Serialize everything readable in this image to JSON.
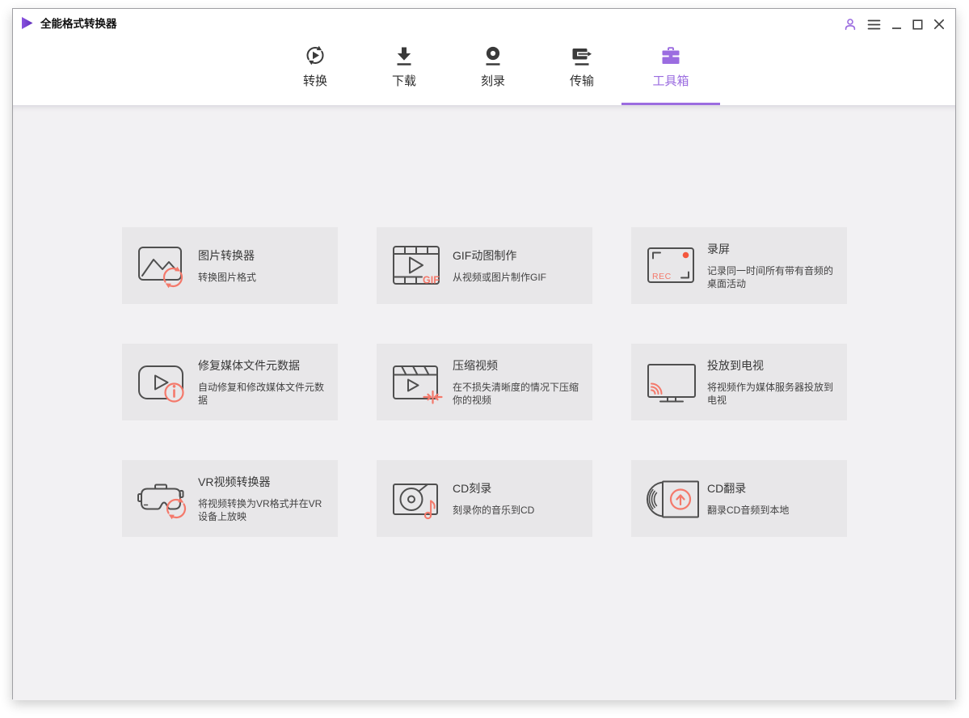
{
  "window": {
    "title": "全能格式转换器"
  },
  "colors": {
    "accent_purple": "#9b6ce0",
    "accent_coral": "#f4796b",
    "record_red": "#f4573d",
    "card_bg": "#e8e7e9",
    "content_bg": "#f2f1f3"
  },
  "nav": {
    "tabs": [
      {
        "label": "转换",
        "icon": "convert-icon",
        "active": false
      },
      {
        "label": "下载",
        "icon": "download-icon",
        "active": false
      },
      {
        "label": "刻录",
        "icon": "burn-icon",
        "active": false
      },
      {
        "label": "传输",
        "icon": "transfer-icon",
        "active": false
      },
      {
        "label": "工具箱",
        "icon": "toolbox-icon",
        "active": true
      }
    ]
  },
  "icon_labels": {
    "gif": "GIF",
    "rec": "REC"
  },
  "toolbox": {
    "cards": [
      {
        "title": "图片转换器",
        "subtitle": "转换图片格式",
        "icon": "image-converter-icon"
      },
      {
        "title": "GIF动图制作",
        "subtitle": "从视频或图片制作GIF",
        "icon": "gif-maker-icon"
      },
      {
        "title": "录屏",
        "subtitle": "记录同一时间所有带有音频的桌面活动",
        "icon": "screen-recorder-icon"
      },
      {
        "title": "修复媒体文件元数据",
        "subtitle": "自动修复和修改媒体文件元数据",
        "icon": "fix-metadata-icon"
      },
      {
        "title": "压缩视频",
        "subtitle": "在不损失清晰度的情况下压缩你的视频",
        "icon": "compress-video-icon"
      },
      {
        "title": "投放到电视",
        "subtitle": "将视频作为媒体服务器投放到电视",
        "icon": "cast-to-tv-icon"
      },
      {
        "title": "VR视频转换器",
        "subtitle": "将视频转换为VR格式并在VR设备上放映",
        "icon": "vr-converter-icon"
      },
      {
        "title": "CD刻录",
        "subtitle": "刻录你的音乐到CD",
        "icon": "cd-burn-icon"
      },
      {
        "title": "CD翻录",
        "subtitle": "翻录CD音频到本地",
        "icon": "cd-rip-icon"
      }
    ]
  }
}
